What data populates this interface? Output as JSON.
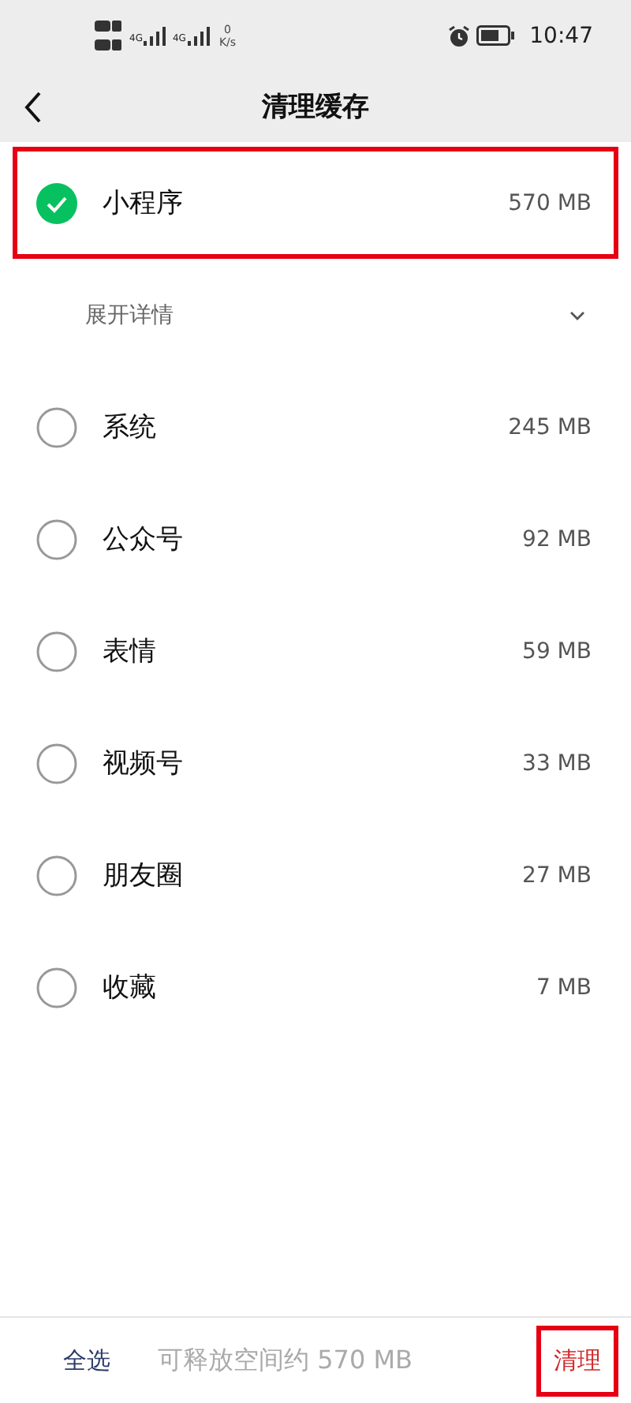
{
  "status_bar": {
    "networks": [
      "4G",
      "4G"
    ],
    "speed_value": "0",
    "speed_unit": "K/s",
    "time": "10:47"
  },
  "header": {
    "title": "清理缓存"
  },
  "items": [
    {
      "name": "小程序",
      "size": "570 MB",
      "checked": true,
      "highlighted": true
    }
  ],
  "details": {
    "label": "展开详情",
    "expanded": false
  },
  "more_items": [
    {
      "name": "系统",
      "size": "245 MB",
      "checked": false,
      "highlighted": false
    },
    {
      "name": "公众号",
      "size": "92 MB",
      "checked": false,
      "highlighted": false
    },
    {
      "name": "表情",
      "size": "59 MB",
      "checked": false,
      "highlighted": false
    },
    {
      "name": "视频号",
      "size": "33 MB",
      "checked": false,
      "highlighted": false
    },
    {
      "name": "朋友圈",
      "size": "27 MB",
      "checked": false,
      "highlighted": false
    },
    {
      "name": "收藏",
      "size": "7 MB",
      "checked": false,
      "highlighted": false
    }
  ],
  "footer": {
    "select_all": "全选",
    "summary": "可释放空间约 570 MB",
    "clean": "清理",
    "clean_highlighted": true
  }
}
